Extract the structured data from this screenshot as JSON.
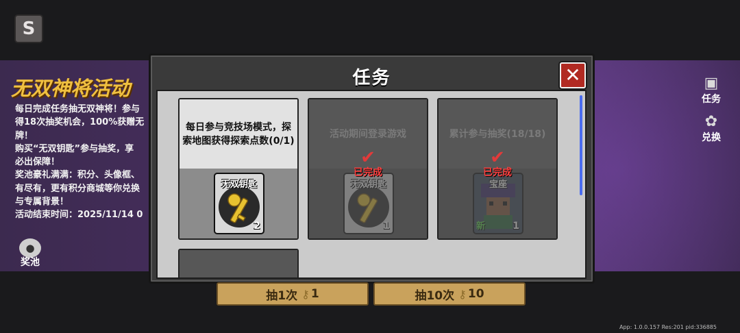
{
  "background": {
    "event_title": "无双神将活动",
    "event_desc": [
      "每日完成任务抽无双神将！参与",
      "得18次抽奖机会，100%获赠无",
      "牌！",
      "购买“无双钥匙”参与抽奖，享",
      "必出保障！",
      "奖池豪礼满满：积分、头像框、",
      "有尽有，更有积分商城等你兑换",
      "与专属背景！",
      "活动结束时间：2025/11/14 0"
    ],
    "prize_pool_label": "奖池",
    "side_tabs": [
      {
        "label": "任务",
        "icon": "task-icon"
      },
      {
        "label": "兑换",
        "icon": "exchange-icon"
      }
    ],
    "back_icon": "back-s-icon"
  },
  "dialog": {
    "title": "任务",
    "close_icon": "close-x-icon",
    "tasks": [
      {
        "description": "每日参与竞技场模式，探索地图获得探索点数(0/1)",
        "reward_name": "无双钥匙",
        "reward_count": "2",
        "completed": false
      },
      {
        "description": "活动期间登录游戏",
        "reward_name": "无双钥匙",
        "reward_count": "1",
        "completed": true,
        "status_label": "已完成"
      },
      {
        "description": "累计参与抽奖(18/18)",
        "reward_name": "宝座",
        "reward_count": "1",
        "reward_tag": "新",
        "completed": true,
        "status_label": "已完成"
      }
    ]
  },
  "draw_buttons": [
    {
      "label": "抽1次",
      "cost": "1"
    },
    {
      "label": "抽10次",
      "cost": "10"
    }
  ],
  "app_info": "App: 1.0.0.157 Res:201 pid:336885"
}
